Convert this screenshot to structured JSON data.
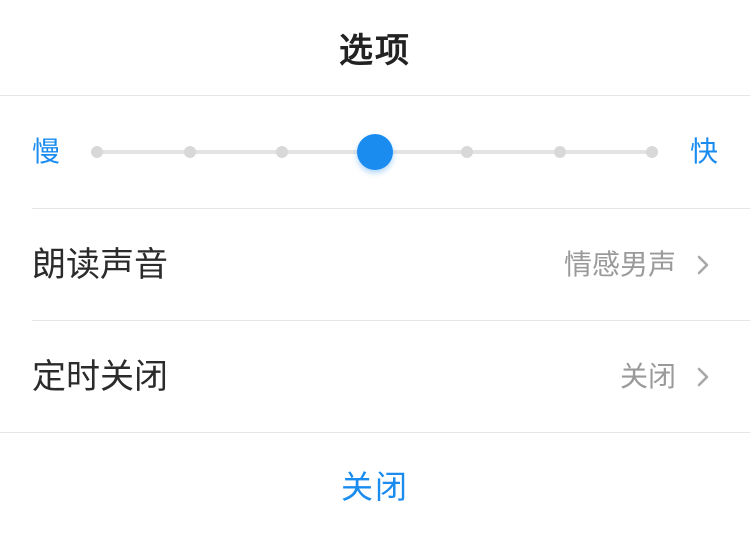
{
  "header": {
    "title": "选项"
  },
  "speed": {
    "slow_label": "慢",
    "fast_label": "快",
    "steps": 7,
    "selected_index": 3
  },
  "options": [
    {
      "label": "朗读声音",
      "value": "情感男声"
    },
    {
      "label": "定时关闭",
      "value": "关闭"
    }
  ],
  "footer": {
    "close_label": "关闭"
  },
  "colors": {
    "accent": "#1a8cf0",
    "track": "#e3e3e3",
    "dot": "#d8d8d8",
    "value_text": "#9a9a9a",
    "label_text": "#2b2b2b"
  },
  "icons": {
    "row_chevron": "chevron-right-icon"
  }
}
